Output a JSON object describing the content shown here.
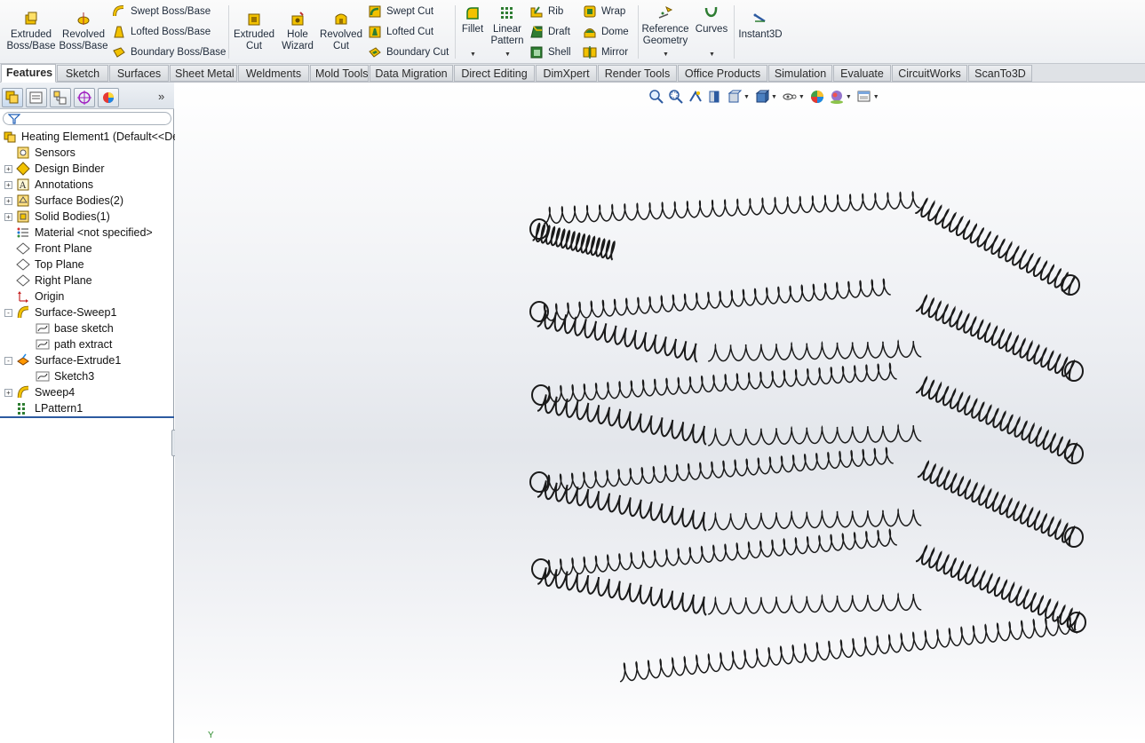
{
  "ribbon": {
    "extruded_boss": "Extruded\nBoss/Base",
    "revolved_boss": "Revolved\nBoss/Base",
    "swept_boss": "Swept Boss/Base",
    "lofted_boss": "Lofted Boss/Base",
    "boundary_boss": "Boundary Boss/Base",
    "extruded_cut": "Extruded\nCut",
    "hole_wizard": "Hole\nWizard",
    "revolved_cut": "Revolved\nCut",
    "swept_cut": "Swept Cut",
    "lofted_cut": "Lofted Cut",
    "boundary_cut": "Boundary Cut",
    "fillet": "Fillet",
    "linear_pattern": "Linear\nPattern",
    "rib": "Rib",
    "draft": "Draft",
    "shell": "Shell",
    "wrap": "Wrap",
    "dome": "Dome",
    "mirror": "Mirror",
    "reference_geometry": "Reference\nGeometry",
    "curves": "Curves",
    "instant3d": "Instant3D"
  },
  "tabs": [
    "Features",
    "Sketch",
    "Surfaces",
    "Sheet Metal",
    "Weldments",
    "Mold Tools",
    "Data Migration",
    "Direct Editing",
    "DimXpert",
    "Render Tools",
    "Office Products",
    "Simulation",
    "Evaluate",
    "CircuitWorks",
    "ScanTo3D"
  ],
  "active_tab": "Features",
  "tree": {
    "root": "Heating Element1  (Default<<De",
    "items": [
      {
        "label": "Sensors",
        "icon": "sensor-icon"
      },
      {
        "label": "Design Binder",
        "icon": "binder-icon"
      },
      {
        "label": "Annotations",
        "icon": "annotation-icon"
      },
      {
        "label": "Surface Bodies(2)",
        "icon": "surface-bodies-icon"
      },
      {
        "label": "Solid Bodies(1)",
        "icon": "solid-bodies-icon"
      },
      {
        "label": "Material <not specified>",
        "icon": "material-icon"
      },
      {
        "label": "Front Plane",
        "icon": "plane-icon"
      },
      {
        "label": "Top Plane",
        "icon": "plane-icon"
      },
      {
        "label": "Right Plane",
        "icon": "plane-icon"
      },
      {
        "label": "Origin",
        "icon": "origin-icon"
      },
      {
        "label": "Surface-Sweep1",
        "icon": "sweep-icon"
      },
      {
        "label": "base sketch",
        "icon": "sketch-icon"
      },
      {
        "label": "path extract",
        "icon": "sketch-icon"
      },
      {
        "label": "Surface-Extrude1",
        "icon": "extrude-icon"
      },
      {
        "label": "Sketch3",
        "icon": "sketch-icon"
      },
      {
        "label": "Sweep4",
        "icon": "sweep-icon"
      },
      {
        "label": "LPattern1",
        "icon": "pattern-icon"
      }
    ]
  },
  "viewport": {
    "triad_label": "Y"
  },
  "colors": {
    "accent": "#2c5aa0",
    "feature_yellow": "#f2c200",
    "coil_stroke": "#1a1a1a"
  }
}
